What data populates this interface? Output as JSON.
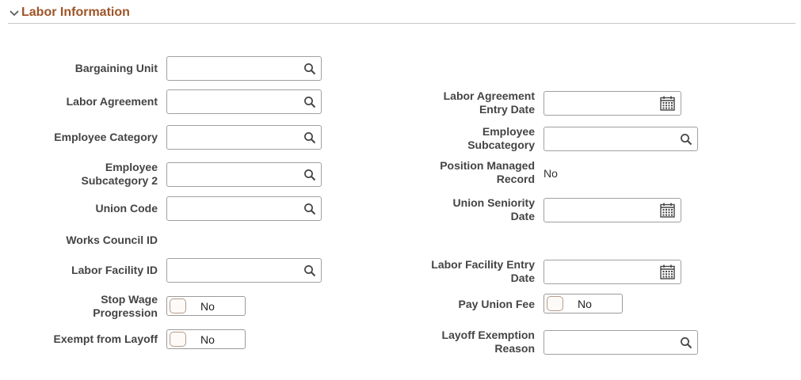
{
  "section": {
    "title": "Labor Information"
  },
  "left": {
    "bargaining_unit": {
      "label": "Bargaining Unit",
      "value": ""
    },
    "labor_agreement": {
      "label": "Labor Agreement",
      "value": ""
    },
    "employee_category": {
      "label": "Employee Category",
      "value": ""
    },
    "employee_subcategory2": {
      "label_line1": "Employee",
      "label_line2": "Subcategory 2",
      "value": ""
    },
    "union_code": {
      "label": "Union Code",
      "value": ""
    },
    "works_council_id": {
      "label": "Works Council ID"
    },
    "labor_facility_id": {
      "label": "Labor Facility ID",
      "value": ""
    },
    "stop_wage_progression": {
      "label_line1": "Stop Wage",
      "label_line2": "Progression",
      "state": "No"
    },
    "exempt_from_layoff": {
      "label": "Exempt from Layoff",
      "state": "No"
    }
  },
  "right": {
    "labor_agreement_entry_date": {
      "label_line1": "Labor Agreement",
      "label_line2": "Entry Date",
      "value": ""
    },
    "employee_subcategory": {
      "label_line1": "Employee",
      "label_line2": "Subcategory",
      "value": ""
    },
    "position_managed_record": {
      "label_line1": "Position Managed",
      "label_line2": "Record",
      "value": "No"
    },
    "union_seniority_date": {
      "label_line1": "Union Seniority",
      "label_line2": "Date",
      "value": ""
    },
    "labor_facility_entry_date": {
      "label_line1": "Labor Facility Entry",
      "label_line2": "Date",
      "value": ""
    },
    "pay_union_fee": {
      "label": "Pay Union Fee",
      "state": "No"
    },
    "layoff_exemption_reason": {
      "label_line1": "Layoff Exemption",
      "label_line2": "Reason",
      "value": ""
    }
  },
  "icons": {
    "prompt": "search-icon",
    "date": "calendar-icon",
    "collapse": "chevron-down-icon"
  },
  "colors": {
    "section_title": "#9e5427",
    "label": "#444444",
    "field_border": "#a0a0a0"
  }
}
